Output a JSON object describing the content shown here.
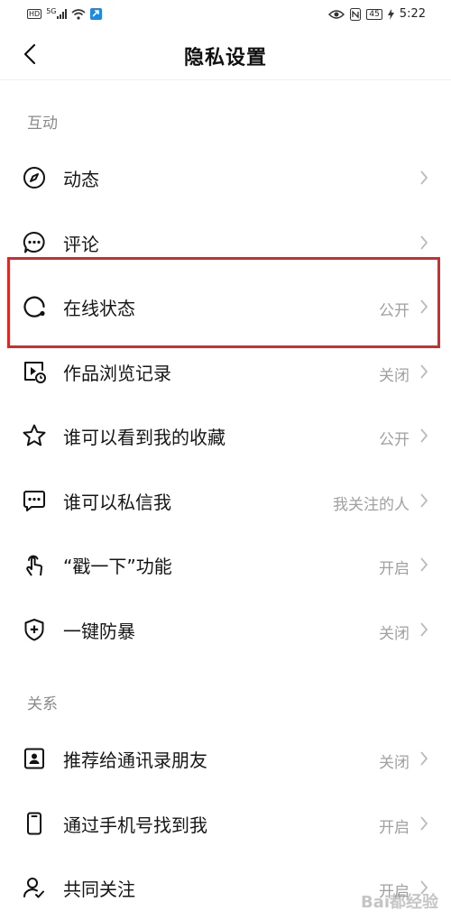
{
  "status_bar": {
    "hd": "HD",
    "network": "5G",
    "battery": "45",
    "time": "5:22"
  },
  "header": {
    "title": "隐私设置"
  },
  "sections": [
    {
      "title": "互动",
      "items": [
        {
          "label": "动态",
          "value": "",
          "icon": "compass-icon"
        },
        {
          "label": "评论",
          "value": "",
          "icon": "comment-bubble-icon"
        },
        {
          "label": "在线状态",
          "value": "公开",
          "icon": "online-status-icon",
          "highlighted": true
        },
        {
          "label": "作品浏览记录",
          "value": "关闭",
          "icon": "video-history-icon"
        },
        {
          "label": "谁可以看到我的收藏",
          "value": "公开",
          "icon": "star-icon"
        },
        {
          "label": "谁可以私信我",
          "value": "我关注的人",
          "icon": "message-icon"
        },
        {
          "label": "“戳一下”功能",
          "value": "开启",
          "icon": "poke-hand-icon"
        },
        {
          "label": "一键防暴",
          "value": "关闭",
          "icon": "shield-plus-icon"
        }
      ]
    },
    {
      "title": "关系",
      "items": [
        {
          "label": "推荐给通讯录朋友",
          "value": "关闭",
          "icon": "contact-card-icon"
        },
        {
          "label": "通过手机号找到我",
          "value": "开启",
          "icon": "phone-icon"
        },
        {
          "label": "共同关注",
          "value": "开启",
          "icon": "mutual-follow-icon"
        }
      ]
    }
  ],
  "watermark": "Bai都经验",
  "colors": {
    "highlight": "#d42a2a",
    "secondary_text": "#a0a0a0"
  }
}
